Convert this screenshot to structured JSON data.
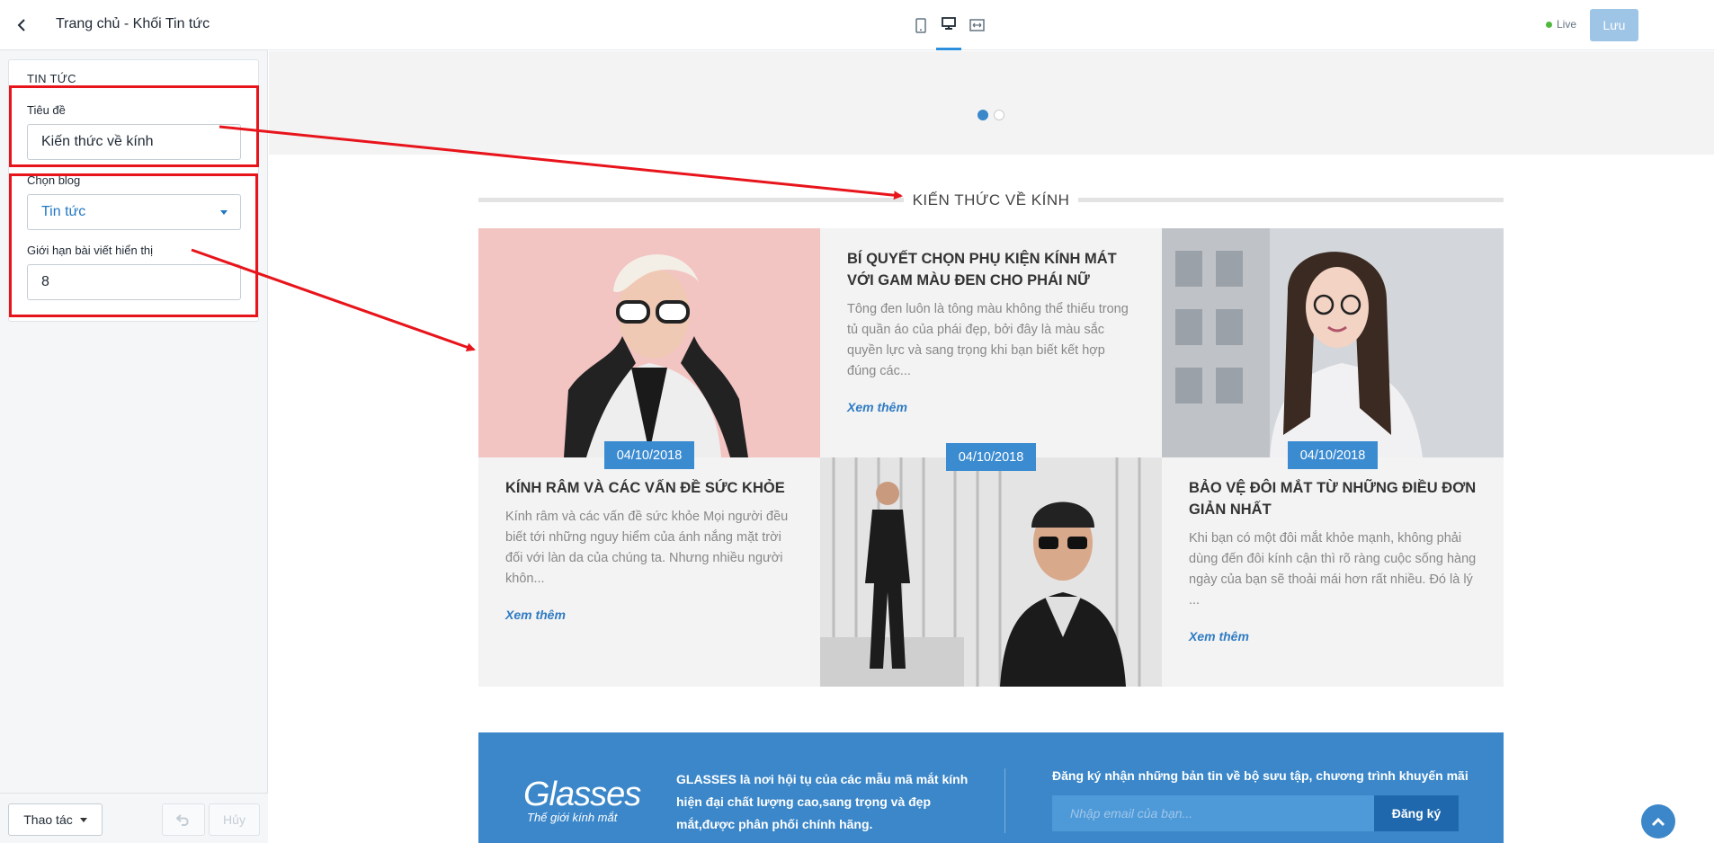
{
  "editor": {
    "title": "Trang chủ - Khối Tin tức",
    "panel_heading": "TIN TỨC",
    "title_label": "Tiêu đề",
    "title_value": "Kiến thức về kính",
    "blog_label": "Chọn blog",
    "blog_value": "Tin tức",
    "limit_label": "Giới hạn bài viết hiển thị",
    "limit_value": "8",
    "actions_label": "Thao tác",
    "cancel_label": "Hủy"
  },
  "topbar": {
    "devices": [
      "mobile-icon",
      "desktop-icon",
      "fullwidth-icon"
    ],
    "active_device": "desktop",
    "status_label": "Live",
    "save_label": "Lưu",
    "accent": "#2b8fde"
  },
  "preview": {
    "slider_dots": 2,
    "slider_active": 1,
    "section_title": "KIẾN THỨC VỀ KÍNH",
    "read_more": "Xem thêm",
    "posts": [
      {
        "date": "04/10/2018",
        "title": "KÍNH RÂM VÀ CÁC VẤN ĐỀ SỨC KHỎE",
        "excerpt": "Kính râm và các vấn đề sức khỏe Mọi người đều biết tới những nguy hiểm của ánh nắng mặt trời đối với làn da của chúng ta. Nhưng nhiều người khôn..."
      },
      {
        "date": "04/10/2018",
        "title": "BÍ QUYẾT CHỌN PHỤ KIỆN KÍNH MÁT VỚI GAM MÀU ĐEN CHO PHÁI NỮ",
        "excerpt": "Tông đen luôn là tông màu không thể thiếu trong tủ quần áo của phái đẹp, bởi đây là màu sắc quyền lực và sang trọng khi bạn biết kết hợp đúng các..."
      },
      {
        "date": "04/10/2018",
        "title": "BẢO VỆ ĐÔI MẮT TỪ NHỮNG ĐIỀU ĐƠN GIẢN NHẤT",
        "excerpt": "Khi bạn có một đôi mắt khỏe mạnh, không phải dùng đến đôi kính cận thì rõ ràng cuộc sống hàng ngày của bạn sẽ thoải mái hơn rất nhiều. Đó là lý ..."
      }
    ],
    "footer": {
      "logo": "Glasses",
      "logo_tagline": "Thế giới kính mắt",
      "about": "GLASSES là nơi hội tụ của các mẫu mã mắt kính hiện đại chất lượng cao,sang trọng và đẹp mắt,được phân phối chính hãng.",
      "subscribe_text": "Đăng ký nhận những bản tin về bộ sưu tập, chương trình khuyến mãi",
      "email_placeholder": "Nhập email của bạn...",
      "subscribe_button": "Đăng ký"
    }
  }
}
